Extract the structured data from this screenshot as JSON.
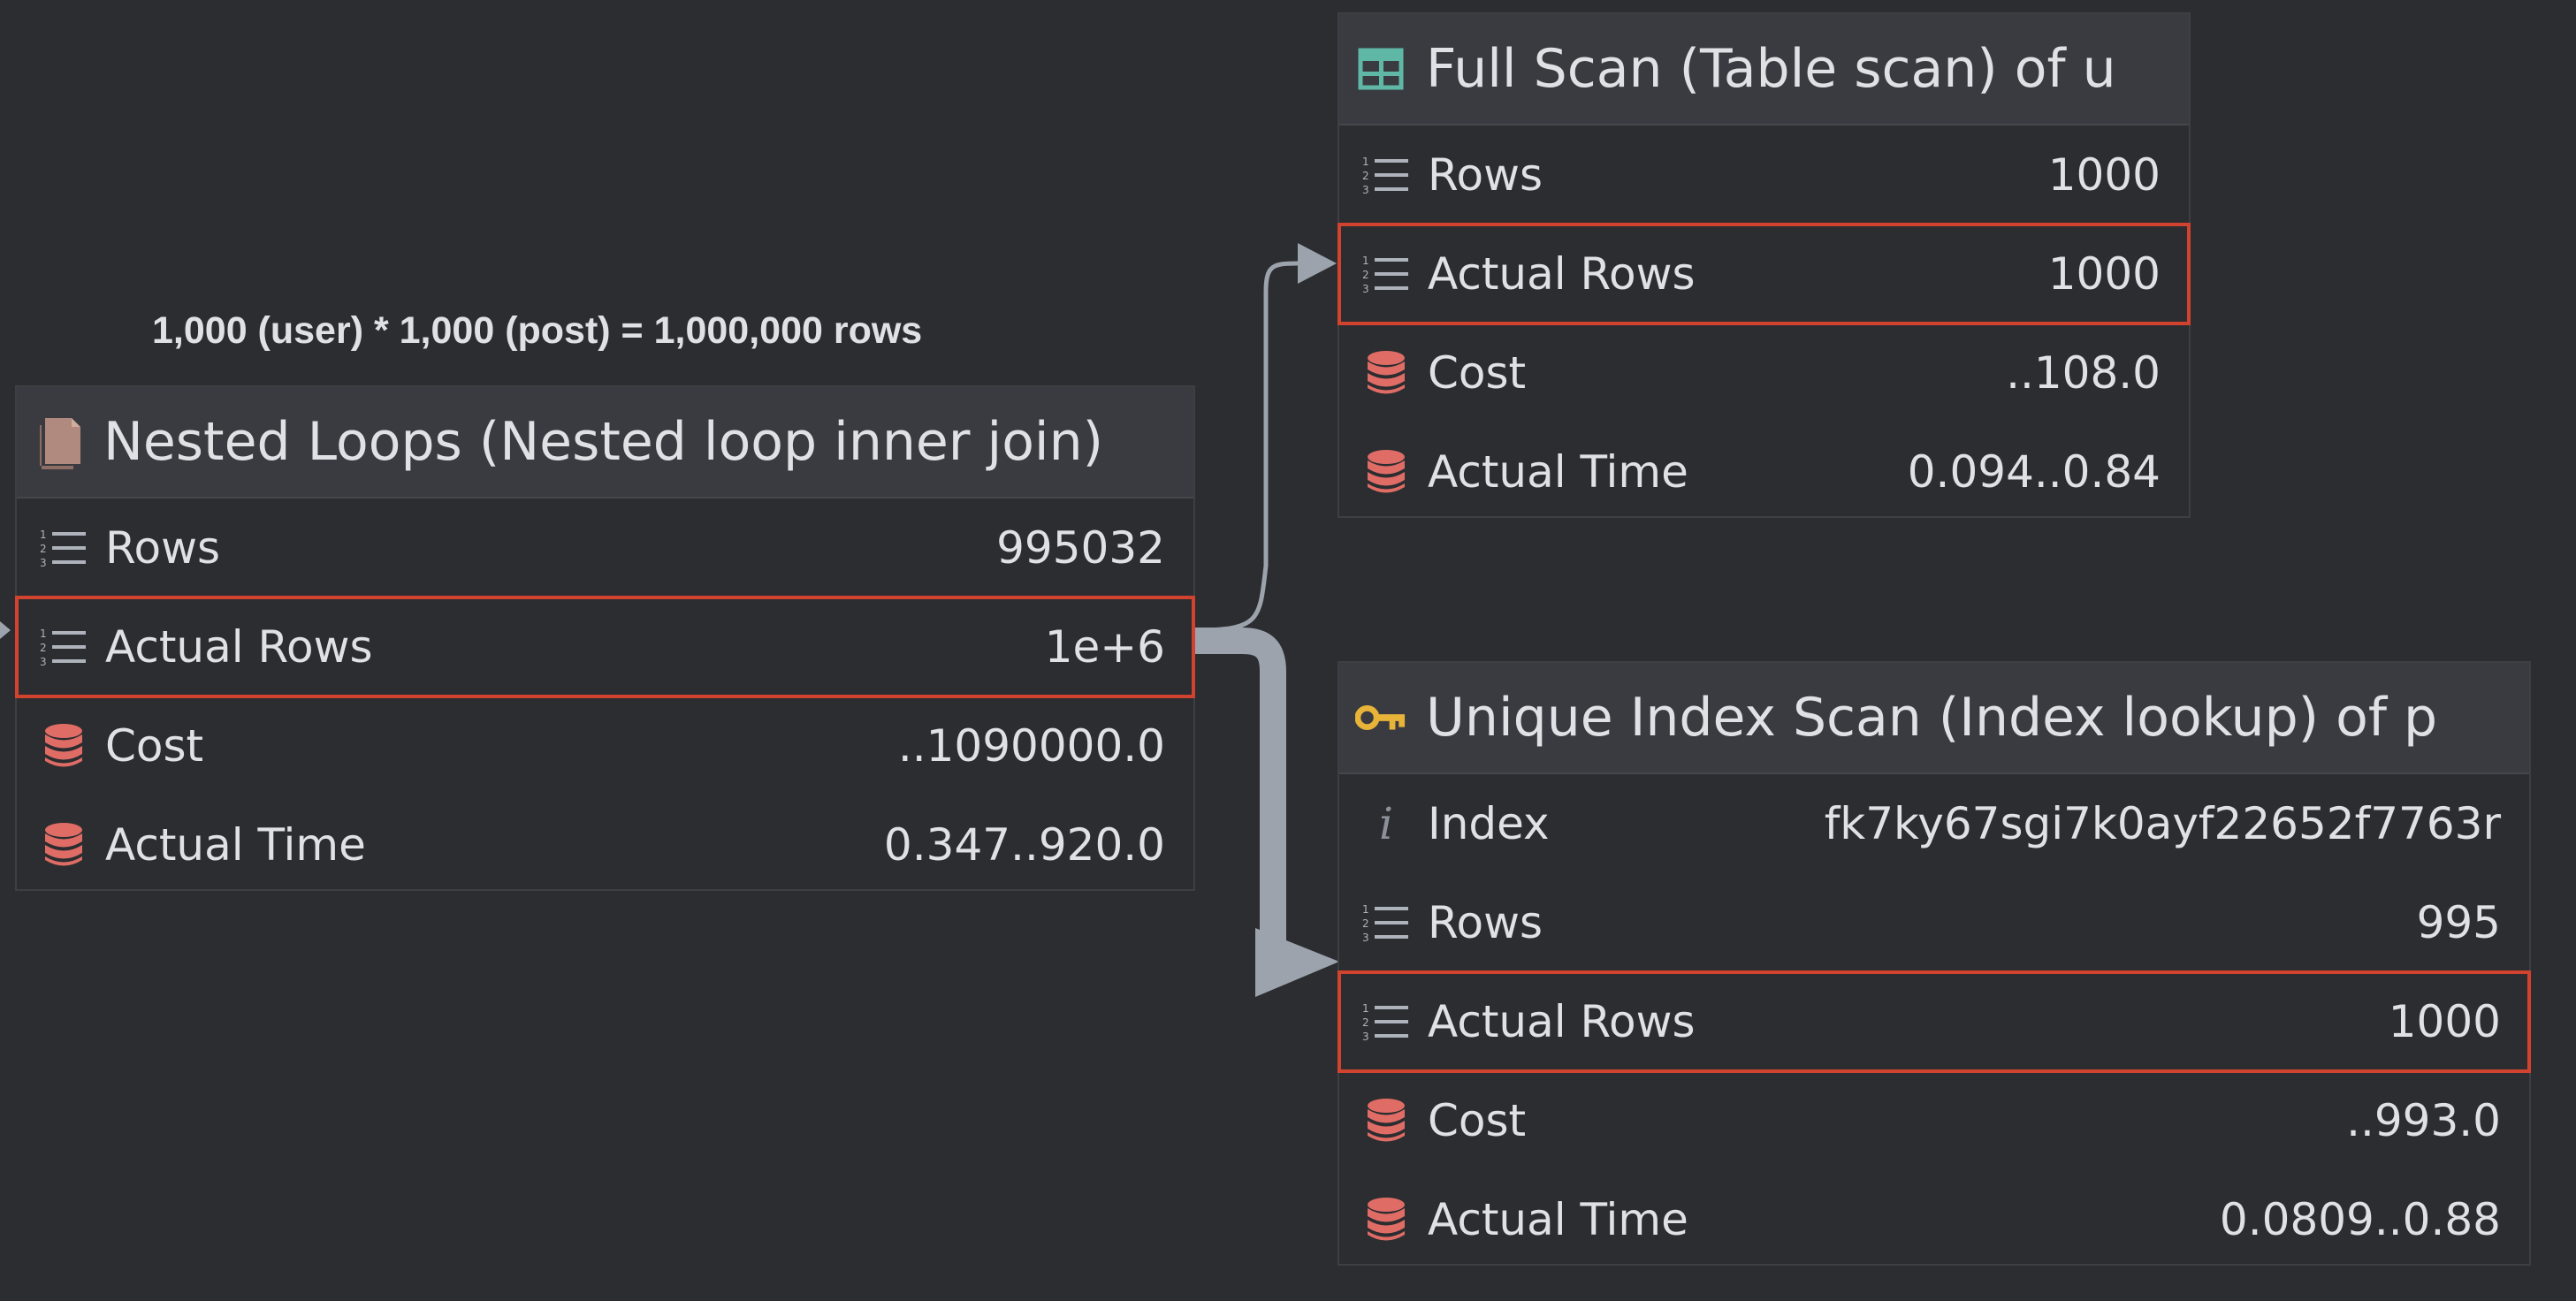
{
  "annotation": "1,000 (user) * 1,000 (post) = 1,000,000 rows",
  "colors": {
    "background": "#2b2d30",
    "header": "#393b40",
    "highlight": "#d1432e",
    "db_icon": "#e06c66",
    "table_icon": "#5fb8a6",
    "key_icon": "#e8b339",
    "file_icon": "#b08a7e",
    "connector": "#9da3ad"
  },
  "nodes": {
    "nested": {
      "title": "Nested Loops (Nested loop inner join)",
      "icon": "file-icon",
      "rows": [
        {
          "icon": "rows-list-icon",
          "label": "Rows",
          "value": "995032"
        },
        {
          "icon": "rows-list-icon",
          "label": "Actual Rows",
          "value": "1e+6"
        },
        {
          "icon": "database-icon",
          "label": "Cost",
          "value": "..1090000.0"
        },
        {
          "icon": "database-icon",
          "label": "Actual Time",
          "value": "0.347..920.0"
        }
      ]
    },
    "fullscan": {
      "title": "Full Scan (Table scan) of u",
      "icon": "table-icon",
      "rows": [
        {
          "icon": "rows-list-icon",
          "label": "Rows",
          "value": "1000"
        },
        {
          "icon": "rows-list-icon",
          "label": "Actual Rows",
          "value": "1000"
        },
        {
          "icon": "database-icon",
          "label": "Cost",
          "value": "..108.0"
        },
        {
          "icon": "database-icon",
          "label": "Actual Time",
          "value": "0.094..0.84"
        }
      ]
    },
    "indexscan": {
      "title": "Unique Index Scan (Index lookup) of p",
      "icon": "key-icon",
      "rows": [
        {
          "icon": "info-icon",
          "label": "Index",
          "value": "fk7ky67sgi7k0ayf22652f7763r"
        },
        {
          "icon": "rows-list-icon",
          "label": "Rows",
          "value": "995"
        },
        {
          "icon": "rows-list-icon",
          "label": "Actual Rows",
          "value": "1000"
        },
        {
          "icon": "database-icon",
          "label": "Cost",
          "value": "..993.0"
        },
        {
          "icon": "database-icon",
          "label": "Actual Time",
          "value": "0.0809..0.88"
        }
      ]
    }
  }
}
